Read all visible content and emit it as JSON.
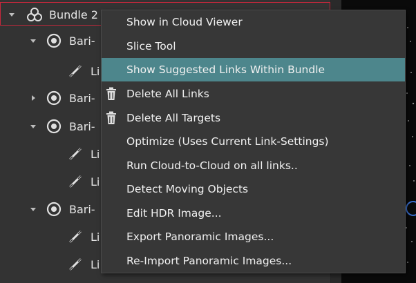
{
  "tree": {
    "items": [
      {
        "label": "Bundle 2",
        "icon": "bundle-icon",
        "expander": "expanded"
      },
      {
        "label": "Bari-",
        "icon": "target-icon",
        "expander": "expanded"
      },
      {
        "label": "Li",
        "icon": "link-icon"
      },
      {
        "label": "Bari-",
        "icon": "target-icon",
        "expander": "collapsed"
      },
      {
        "label": "Bari-",
        "icon": "target-icon",
        "expander": "expanded"
      },
      {
        "label": "Li",
        "icon": "link-icon"
      },
      {
        "label": "Li",
        "icon": "link-icon"
      },
      {
        "label": "Bari-",
        "icon": "target-icon",
        "expander": "expanded"
      },
      {
        "label": "Li",
        "icon": "link-icon"
      },
      {
        "label": "Li",
        "icon": "link-icon"
      }
    ]
  },
  "context_menu": {
    "items": [
      {
        "label": "Show in Cloud Viewer"
      },
      {
        "label": "Slice Tool"
      },
      {
        "label": "Show Suggested Links Within Bundle",
        "highlighted": true
      },
      {
        "label": "Delete All Links",
        "icon": "trash-icon"
      },
      {
        "label": "Delete All Targets",
        "icon": "trash-icon"
      },
      {
        "label": "Optimize (Uses Current Link-Settings)"
      },
      {
        "label": "Run Cloud-to-Cloud on all links.."
      },
      {
        "label": "Detect Moving Objects"
      },
      {
        "label": "Edit HDR Image..."
      },
      {
        "label": "Export Panoramic Images..."
      },
      {
        "label": "Re-Import Panoramic Images..."
      }
    ]
  },
  "colors": {
    "panel_bg": "#333333",
    "menu_bg": "#373737",
    "highlight": "#4d868c",
    "selection_border": "#c8283c",
    "viewer_bg": "#0a0a0a"
  }
}
